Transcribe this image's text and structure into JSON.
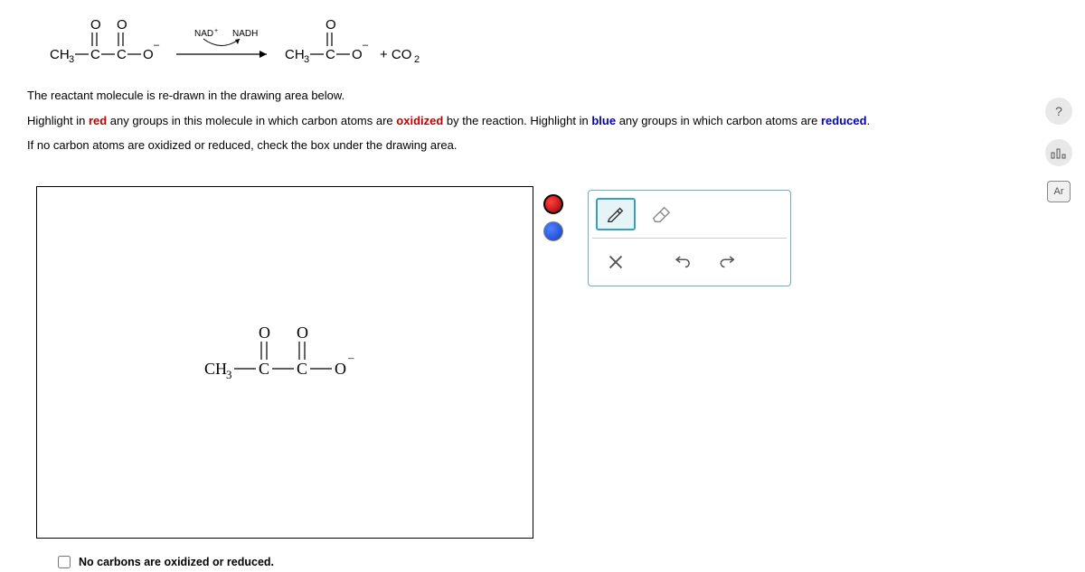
{
  "reaction": {
    "reactant_label": "CH3",
    "product_label": "CH3",
    "cofactor_left": "NAD+",
    "cofactor_right": "NADH",
    "product_suffix": "+ CO2"
  },
  "instructions": {
    "line1": "The reactant molecule is re-drawn in the drawing area below.",
    "line2_a": "Highlight in ",
    "line2_red": "red",
    "line2_b": " any groups in this molecule in which carbon atoms are ",
    "line2_ox": "oxidized",
    "line2_c": " by the reaction. Highlight in ",
    "line2_blue": "blue",
    "line2_d": " any groups in which carbon atoms are ",
    "line2_re": "reduced",
    "line2_e": ".",
    "line3": "If no carbon atoms are oxidized or reduced, check the box under the drawing area."
  },
  "drawing": {
    "molecule_ch3": "CH",
    "molecule_sub3": "3",
    "molecule_c": "C",
    "molecule_o": "O"
  },
  "checkbox": {
    "label": "No carbons are oxidized or reduced."
  },
  "side": {
    "help": "?",
    "ar": "Ar"
  }
}
